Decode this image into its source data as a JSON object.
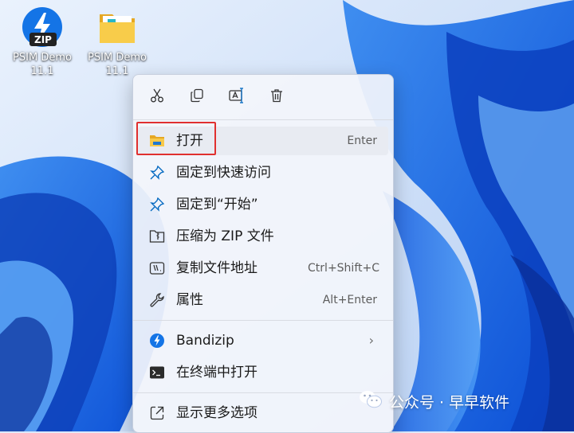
{
  "desktop": {
    "icons": [
      {
        "label": "PSIM Demo 11.1",
        "icon": "bandizip-zip-icon"
      },
      {
        "label": "PSIM Demo 11.1",
        "icon": "folder-icon"
      }
    ]
  },
  "menu": {
    "toolbar": [
      {
        "icon": "cut-icon"
      },
      {
        "icon": "copy-icon"
      },
      {
        "icon": "rename-icon"
      },
      {
        "icon": "delete-icon"
      }
    ],
    "items": [
      {
        "label": "打开",
        "accel": "Enter",
        "icon": "folder-open-icon"
      },
      {
        "label": "固定到快速访问",
        "icon": "pin-icon"
      },
      {
        "label": "固定到“开始”",
        "icon": "pin-icon"
      },
      {
        "label": "压缩为 ZIP 文件",
        "icon": "zip-icon"
      },
      {
        "label": "复制文件地址",
        "accel": "Ctrl+Shift+C",
        "icon": "copy-path-icon"
      },
      {
        "label": "属性",
        "accel": "Alt+Enter",
        "icon": "wrench-icon"
      },
      {
        "label": "Bandizip",
        "icon": "bandizip-icon",
        "submenu": true
      },
      {
        "label": "在终端中打开",
        "icon": "terminal-icon"
      },
      {
        "label": "显示更多选项",
        "icon": "more-options-icon"
      }
    ]
  },
  "watermark": {
    "text": "公众号 · 早早软件",
    "icon": "wechat-icon"
  },
  "colors": {
    "accent": "#0067c0",
    "highlight_border": "#e0302f",
    "menu_bg": "#f3f5fb"
  }
}
